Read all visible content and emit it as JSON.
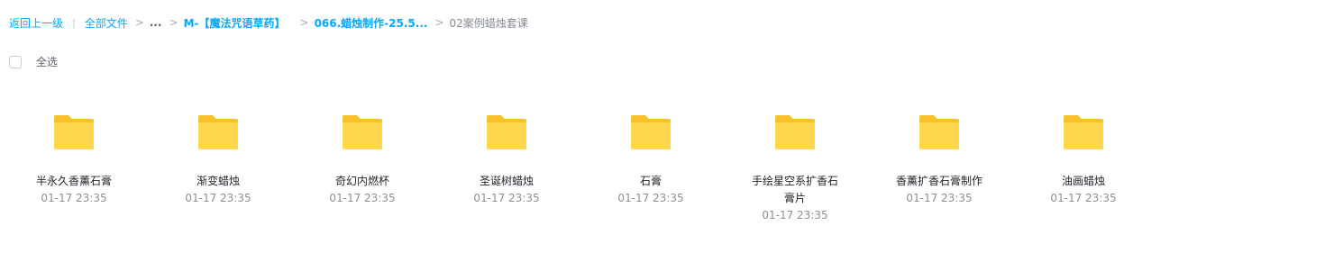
{
  "breadcrumb": {
    "back_label": "返回上一级",
    "separator": "|",
    "all_files_label": "全部文件",
    "ellipsis": "...",
    "folder1": "M-【魔法咒语草药】",
    "folder2": "066.蜡烛制作-25.5...",
    "current": "02案例蜡烛套课",
    "arrow": ">"
  },
  "select_all": {
    "label": "全选"
  },
  "colors": {
    "link": "#06a7ff",
    "folder_back": "#f8c22a",
    "folder_front": "#ffd84d"
  },
  "files": [
    {
      "name": "半永久香薰石膏",
      "time": "01-17 23:35",
      "icon": "folder-icon"
    },
    {
      "name": "渐变蜡烛",
      "time": "01-17 23:35",
      "icon": "folder-icon"
    },
    {
      "name": "奇幻内燃杯",
      "time": "01-17 23:35",
      "icon": "folder-icon"
    },
    {
      "name": "圣诞树蜡烛",
      "time": "01-17 23:35",
      "icon": "folder-icon"
    },
    {
      "name": "石膏",
      "time": "01-17 23:35",
      "icon": "folder-icon"
    },
    {
      "name": "手绘星空系扩香石膏片",
      "time": "01-17 23:35",
      "icon": "folder-icon"
    },
    {
      "name": "香薰扩香石膏制作",
      "time": "01-17 23:35",
      "icon": "folder-icon"
    },
    {
      "name": "油画蜡烛",
      "time": "01-17 23:35",
      "icon": "folder-icon"
    }
  ]
}
